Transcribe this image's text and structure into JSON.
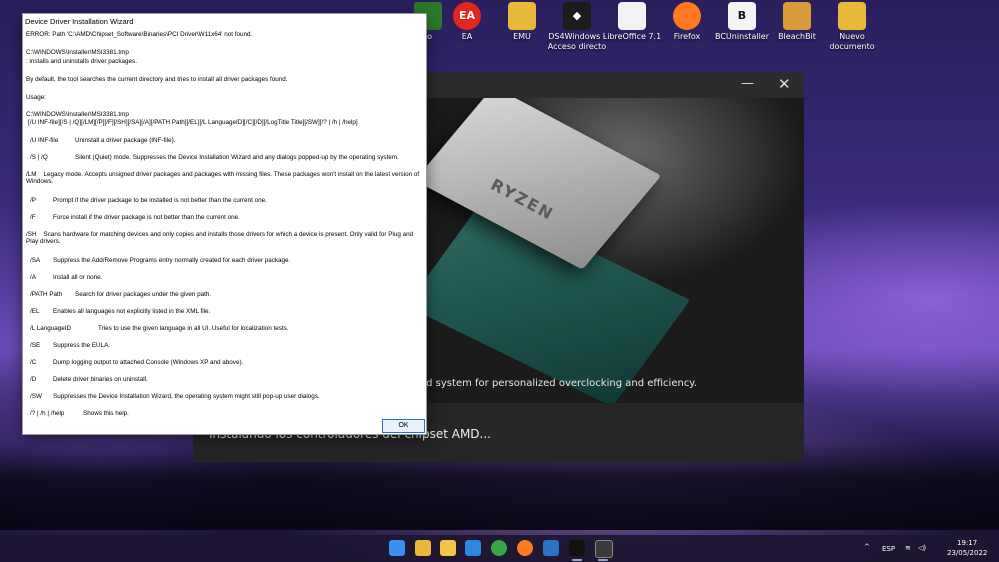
{
  "desktop": {
    "icons": [
      {
        "label": "to",
        "color": "#2a7a2a"
      },
      {
        "label": "EA",
        "color": "#e0261e"
      },
      {
        "label": "EMU",
        "color": "#e7b83a"
      },
      {
        "label": "DS4Windows - Acceso directo",
        "color": "#1c1c1c"
      },
      {
        "label": "LibreOffice 7.1",
        "color": "#f2f2f2"
      },
      {
        "label": "Firefox",
        "color": "#ff7a1f"
      },
      {
        "label": "BCUninstaller",
        "color": "#f5f5f5"
      },
      {
        "label": "BleachBit",
        "color": "#d89c3a"
      },
      {
        "label": "Nuevo documento",
        "color": "#e7b83a"
      }
    ]
  },
  "installer": {
    "tagline": "ed system for personalized overclocking and efficiency.",
    "status": "Instalando los controladores del chipset AMD...",
    "chip_brand": "RYZEN",
    "minimize_glyph": "—",
    "close_glyph": "✕"
  },
  "dialog": {
    "title": "Device Driver Installation Wizard",
    "error": "ERROR: Path 'C:\\AMD\\Chipset_Software\\Binaries\\PCI Driver\\W11x64' not found.",
    "exe_path": "C:\\WINDOWS\\Installer\\MSI3381.tmp",
    "exe_desc": ": installs and uninstalls driver packages.",
    "default_note": "By default, the tool searches the current directory and tries to install all driver packages found.",
    "usage_label": "Usage:",
    "usage_path": "C:\\WINDOWS\\Installer\\MSI3381.tmp",
    "usage_syntax": "[/U INF-file][/S | /Q][/LM][/P][/F][/SH][/SA][/A][/PATH Path][/EL][/L LanguageID][/C][/D][/LogTitle Title][/SW][/? | /h | /help]",
    "options": [
      {
        "switch": "/U INF-file",
        "desc": "Uninstall a driver package (INF-file)."
      },
      {
        "switch": "/S | /Q",
        "desc": "Silent (Quiet) mode. Suppresses the Device Installation Wizard and any dialogs popped-up by the operating system."
      },
      {
        "switch": "/LM",
        "desc": "Legacy mode. Accepts unsigned driver packages and packages with missing files. These packages won't install on the latest version of Windows."
      },
      {
        "switch": "/P",
        "desc": "Prompt if the driver package to be installed is not better than the current one."
      },
      {
        "switch": "/F",
        "desc": "Force install if the driver package is not better than the current one."
      },
      {
        "switch": "/SH",
        "desc": "Scans hardware for matching devices and only copies and installs those drivers for which a device is present. Only valid for Plug and Play drivers."
      },
      {
        "switch": "/SA",
        "desc": "Suppress the Add/Remove Programs entry normally created for each driver package."
      },
      {
        "switch": "/A",
        "desc": "Install all or none."
      },
      {
        "switch": "/PATH Path",
        "desc": "Search for driver packages under the given path."
      },
      {
        "switch": "/EL",
        "desc": "Enables all languages not explicitly listed in the XML file."
      },
      {
        "switch": "/L LanguageID",
        "desc": "Tries to use the given language in all UI. Useful for localization tests."
      },
      {
        "switch": "/SE",
        "desc": "Suppress the EULA."
      },
      {
        "switch": "/C",
        "desc": "Dump logging output to attached Console (Windows XP and above)."
      },
      {
        "switch": "/D",
        "desc": "Delete driver binaries on uninstall."
      },
      {
        "switch": "/SW",
        "desc": "Suppresses the Device Installation Wizard, the operating system might still pop-up user dialogs."
      },
      {
        "switch": "/? | /h | /help",
        "desc": "Shows this help."
      }
    ],
    "ok_label": "OK"
  },
  "taskbar": {
    "language": "ESP",
    "time": "19:17",
    "date": "23/05/2022",
    "chevron": "^",
    "wifi_glyph": "≋",
    "volume_glyph": "◁)",
    "apps": [
      {
        "name": "start",
        "color": "#3c8ef0"
      },
      {
        "name": "file-explorer",
        "color": "#e7b83a"
      },
      {
        "name": "file-explorer-2",
        "color": "#f0c64b"
      },
      {
        "name": "mail",
        "color": "#2f88e0"
      },
      {
        "name": "xbox",
        "color": "#37a645"
      },
      {
        "name": "firefox",
        "color": "#ff7a1f"
      },
      {
        "name": "steam",
        "color": "#2a74c8"
      },
      {
        "name": "amd",
        "color": "#111111"
      },
      {
        "name": "installer",
        "color": "#3a3a3a"
      }
    ]
  }
}
